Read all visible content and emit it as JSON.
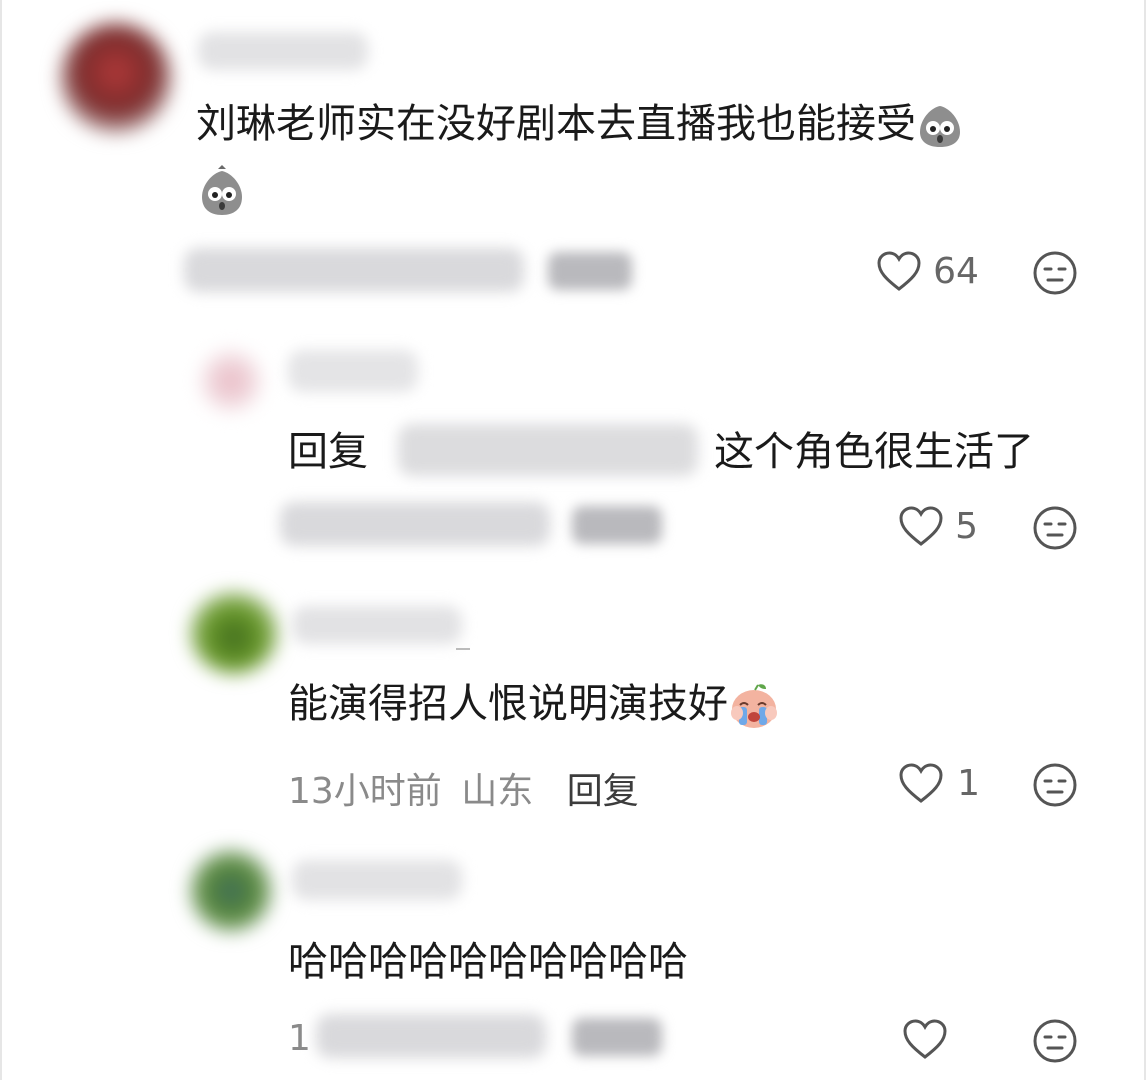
{
  "comments": [
    {
      "text_line1": "刘琳老师实在没好剧本去直播我也能接受",
      "likes": "64",
      "emoji": "potato-shocked-emoji"
    },
    {
      "reply_prefix": "回复",
      "text": "这个角色很生活了",
      "likes": "5"
    },
    {
      "text": "能演得招人恨说明演技好",
      "time": "13小时前",
      "location": "山东",
      "reply_label": "回复",
      "likes": "1",
      "emoji": "crying-peach-emoji"
    },
    {
      "text": "哈哈哈哈哈哈哈哈哈哈",
      "meta_prefix": "1",
      "likes": ""
    }
  ],
  "colors": {
    "text": "#1a1a1a",
    "meta": "#8a8a8a",
    "icon": "#555555"
  },
  "icons": [
    "heart-outline-icon",
    "emoji-face-icon"
  ]
}
